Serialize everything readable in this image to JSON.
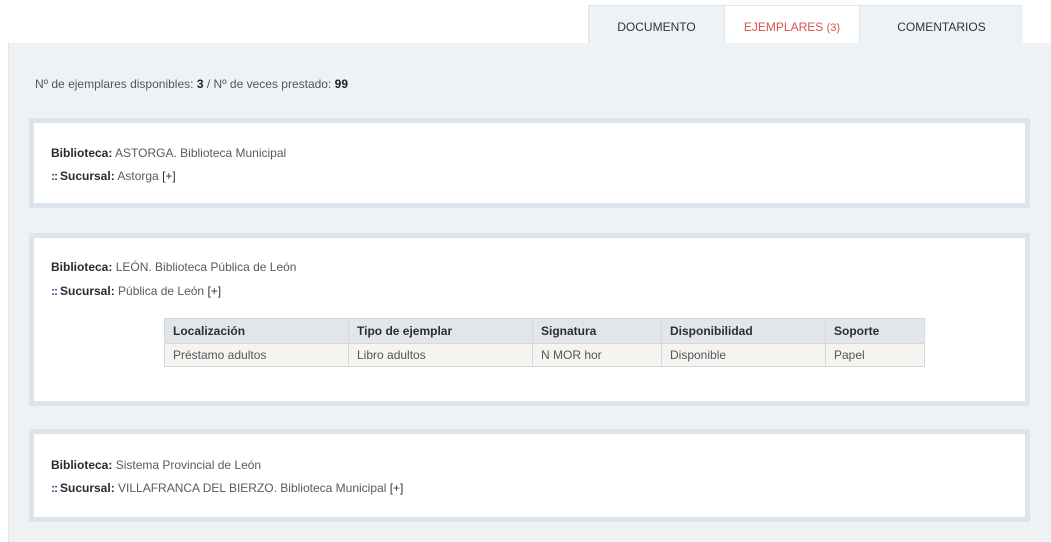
{
  "tabs": [
    {
      "label": "DOCUMENTO"
    },
    {
      "label": "EJEMPLARES",
      "count": "(3)"
    },
    {
      "label": "COMENTARIOS"
    }
  ],
  "summary": {
    "available_label": "Nº de ejemplares disponibles:",
    "available_value": "3",
    "separator": "/",
    "loans_label": "Nº de veces prestado:",
    "loans_value": "99"
  },
  "libraries": [
    {
      "lib_label": "Biblioteca:",
      "lib_value": "ASTORGA. Biblioteca Municipal",
      "branch_label": "Sucursal:",
      "branch_value": "Astorga",
      "toggle": "[+]"
    },
    {
      "lib_label": "Biblioteca:",
      "lib_value": "LEÓN. Biblioteca Pública de León",
      "branch_label": "Sucursal:",
      "branch_value": "Pública de León",
      "toggle": "[+]",
      "table": {
        "headers": [
          "Localización",
          "Tipo de ejemplar",
          "Signatura",
          "Disponibilidad",
          "Soporte"
        ],
        "rows": [
          [
            "Préstamo adultos",
            "Libro adultos",
            "N MOR hor",
            "Disponible",
            "Papel"
          ]
        ]
      }
    },
    {
      "lib_label": "Biblioteca:",
      "lib_value": "Sistema Provincial de León",
      "branch_label": "Sucursal:",
      "branch_value": "VILLAFRANCA DEL BIERZO. Biblioteca Municipal",
      "toggle": "[+]"
    }
  ],
  "colors": {
    "active_tab": "#d9534f",
    "panel_bg": "#eef2f5",
    "card_border": "#dde4eb",
    "bullet": "#2b4a8a"
  }
}
